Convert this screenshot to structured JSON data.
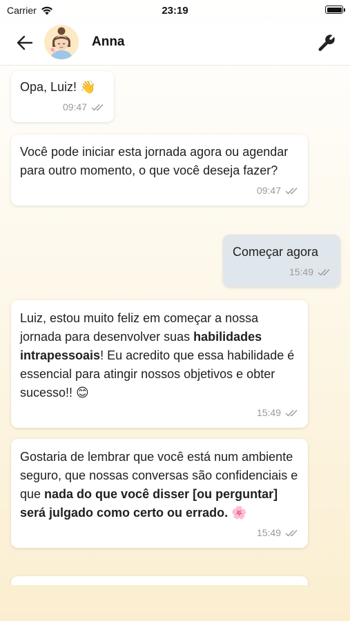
{
  "status": {
    "carrier": "Carrier",
    "time": "23:19"
  },
  "header": {
    "contact_name": "Anna"
  },
  "messages": [
    {
      "time": "09:47",
      "parts": [
        "Opa, Luiz! ",
        "👋"
      ]
    },
    {
      "time": "09:47",
      "parts": [
        "Você pode iniciar esta jornada agora ou agendar para outro momento, o que você deseja fazer?"
      ]
    },
    {
      "time": "15:49",
      "parts": [
        "Começar agora"
      ]
    },
    {
      "time": "15:49",
      "parts": [
        "Luiz, estou muito feliz em começar a nossa jornada para desenvolver suas ",
        "habilidades intrapessoais",
        "! Eu acredito que essa habilidade é essencial para atingir nossos objetivos e obter sucesso!! ",
        "😊"
      ]
    },
    {
      "time": "15:49",
      "parts": [
        "Gostaria de lembrar que você está num ambiente seguro, que nossas conversas são confidenciais e que ",
        "nada do que você disser [ou perguntar] será julgado como certo ou errado.",
        " ",
        "🌸"
      ]
    }
  ]
}
